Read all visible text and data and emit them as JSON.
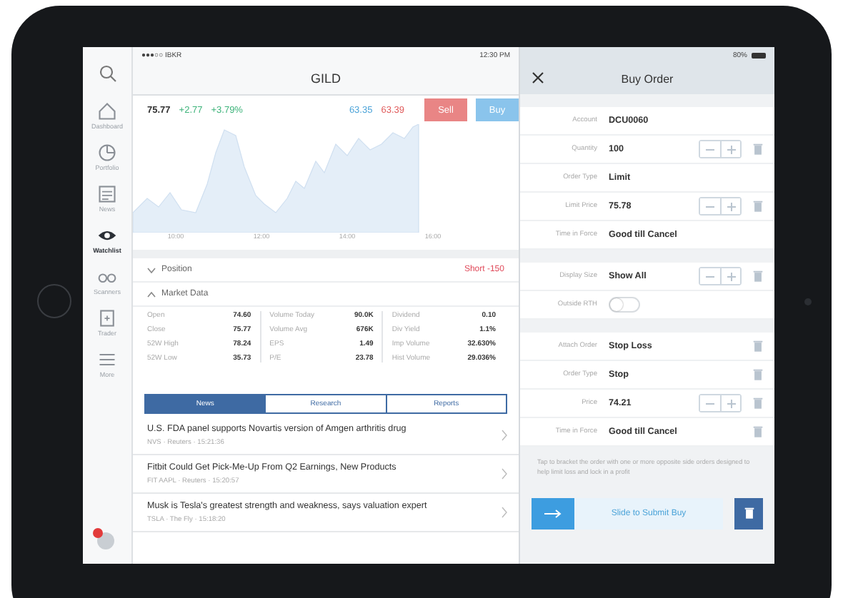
{
  "status_bar": {
    "carrier": "●●●○○ IBKR",
    "time": "12:30 PM",
    "battery": "80%"
  },
  "sidebar": {
    "items": [
      {
        "label": "Dashboard",
        "selected": false
      },
      {
        "label": "Portfolio",
        "selected": false
      },
      {
        "label": "News",
        "selected": false
      },
      {
        "label": "Watchlist",
        "selected": true
      },
      {
        "label": "Scanners",
        "selected": false
      },
      {
        "label": "Trader",
        "selected": false
      },
      {
        "label": "More",
        "selected": false
      }
    ]
  },
  "header": {
    "title": "GILD"
  },
  "quote": {
    "last": "75.77",
    "change": "+2.77",
    "change_pct": "+3.79%",
    "bid": "63.35",
    "ask": "63.39",
    "sell": "Sell",
    "buy": "Buy"
  },
  "chart": {
    "x_labels": [
      "10:00",
      "12:00",
      "14:00",
      "16:00"
    ]
  },
  "position": {
    "label": "Position",
    "expanded": false,
    "value": "Short -150"
  },
  "market_data": {
    "label": "Market Data",
    "expanded": true,
    "groups": [
      [
        {
          "label": "Open",
          "value": "74.60"
        },
        {
          "label": "Close",
          "value": "75.77"
        },
        {
          "label": "52W High",
          "value": "78.24"
        },
        {
          "label": "52W Low",
          "value": "35.73"
        }
      ],
      [
        {
          "label": "Volume Today",
          "value": "90.0K"
        },
        {
          "label": "Volume Avg",
          "value": "676K"
        },
        {
          "label": "EPS",
          "value": "1.49"
        },
        {
          "label": "P/E",
          "value": "23.78"
        }
      ],
      [
        {
          "label": "Dividend",
          "value": "0.10"
        },
        {
          "label": "Div Yield",
          "value": "1.1%"
        },
        {
          "label": "Imp Volume",
          "value": "32.630%"
        },
        {
          "label": "Hist Volume",
          "value": "29.036%"
        }
      ]
    ]
  },
  "tabs": [
    {
      "label": "News",
      "selected": true
    },
    {
      "label": "Research",
      "selected": false
    },
    {
      "label": "Reports",
      "selected": false
    }
  ],
  "news": [
    {
      "headline": "U.S. FDA panel supports Novartis version of Amgen arthritis drug",
      "meta": "NVS · Reuters · 15:21:36"
    },
    {
      "headline": "Fitbit Could Get Pick-Me-Up From Q2 Earnings, New Products",
      "meta": "FIT AAPL · Reuters · 15:20:57"
    },
    {
      "headline": "Musk is Tesla's greatest strength and weakness, says valuation expert",
      "meta": "TSLA · The Fly · 15:18:20"
    }
  ],
  "order": {
    "title": "Buy Order",
    "groups": [
      [
        {
          "kind": "field",
          "label": "Account",
          "value": "DCU0060",
          "stepper": false,
          "trash": false
        },
        {
          "kind": "field",
          "label": "Quantity",
          "value": "100",
          "stepper": true,
          "trash": true
        },
        {
          "kind": "field",
          "label": "Order Type",
          "value": "Limit",
          "stepper": false,
          "trash": false
        },
        {
          "kind": "field",
          "label": "Limit Price",
          "value": "75.78",
          "stepper": true,
          "trash": true
        },
        {
          "kind": "field",
          "label": "Time in Force",
          "value": "Good till Cancel",
          "stepper": false,
          "trash": false
        }
      ],
      [
        {
          "kind": "field",
          "label": "Display Size",
          "value": "Show All",
          "stepper": true,
          "trash": true
        },
        {
          "kind": "toggle",
          "label": "Outside RTH",
          "on": false
        }
      ],
      [
        {
          "kind": "field",
          "label": "Attach Order",
          "value": "Stop Loss",
          "stepper": false,
          "trash": true
        },
        {
          "kind": "field",
          "label": "Order Type",
          "value": "Stop",
          "stepper": false,
          "trash": true
        },
        {
          "kind": "field",
          "label": "Price",
          "value": "74.21",
          "stepper": true,
          "trash": true
        },
        {
          "kind": "field",
          "label": "Time in Force",
          "value": "Good till Cancel",
          "stepper": false,
          "trash": true
        }
      ]
    ],
    "note": "Tap to bracket the order with one or more opposite side orders designed to help limit loss and lock in a profit",
    "submit": "Slide to Submit Buy"
  }
}
